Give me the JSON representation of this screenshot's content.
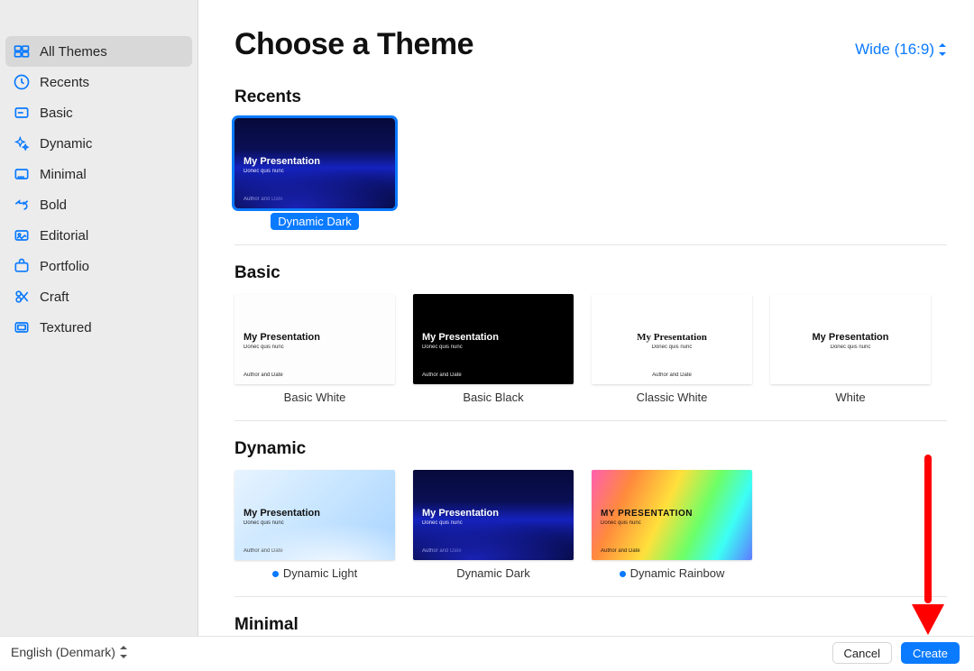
{
  "header": {
    "title": "Choose a Theme",
    "aspect_label": "Wide (16:9)"
  },
  "sidebar": {
    "items": [
      {
        "label": "All Themes",
        "icon": "all-themes-icon",
        "selected": true
      },
      {
        "label": "Recents",
        "icon": "recents-icon"
      },
      {
        "label": "Basic",
        "icon": "basic-icon"
      },
      {
        "label": "Dynamic",
        "icon": "dynamic-icon"
      },
      {
        "label": "Minimal",
        "icon": "minimal-icon"
      },
      {
        "label": "Bold",
        "icon": "bold-icon"
      },
      {
        "label": "Editorial",
        "icon": "editorial-icon"
      },
      {
        "label": "Portfolio",
        "icon": "portfolio-icon"
      },
      {
        "label": "Craft",
        "icon": "craft-icon"
      },
      {
        "label": "Textured",
        "icon": "textured-icon"
      }
    ]
  },
  "thumb_sample": {
    "title": "My Presentation",
    "subtitle": "Donec quis nunc",
    "footer": "Author and Date",
    "title_upper": "MY PRESENTATION"
  },
  "sections": {
    "recents": {
      "title": "Recents",
      "themes": [
        {
          "label": "Dynamic Dark",
          "selected": true,
          "bg": "bg-dyndark",
          "light_text": true
        }
      ]
    },
    "basic": {
      "title": "Basic",
      "themes": [
        {
          "label": "Basic White",
          "bg": "bg-bw"
        },
        {
          "label": "Basic Black",
          "bg": "bg-bb",
          "light_text": true
        },
        {
          "label": "Classic White",
          "bg": "bg-cw"
        },
        {
          "label": "White",
          "bg": "bg-white"
        }
      ]
    },
    "dynamic": {
      "title": "Dynamic",
      "themes": [
        {
          "label": "Dynamic Light",
          "bg": "bg-dynlight",
          "dot": true
        },
        {
          "label": "Dynamic Dark",
          "bg": "bg-dyndark",
          "light_text": true
        },
        {
          "label": "Dynamic Rainbow",
          "bg": "bg-rainbow",
          "dot": true,
          "upper": true
        }
      ]
    },
    "minimal": {
      "title": "Minimal"
    }
  },
  "footer": {
    "language": "English (Denmark)",
    "cancel": "Cancel",
    "create": "Create"
  }
}
